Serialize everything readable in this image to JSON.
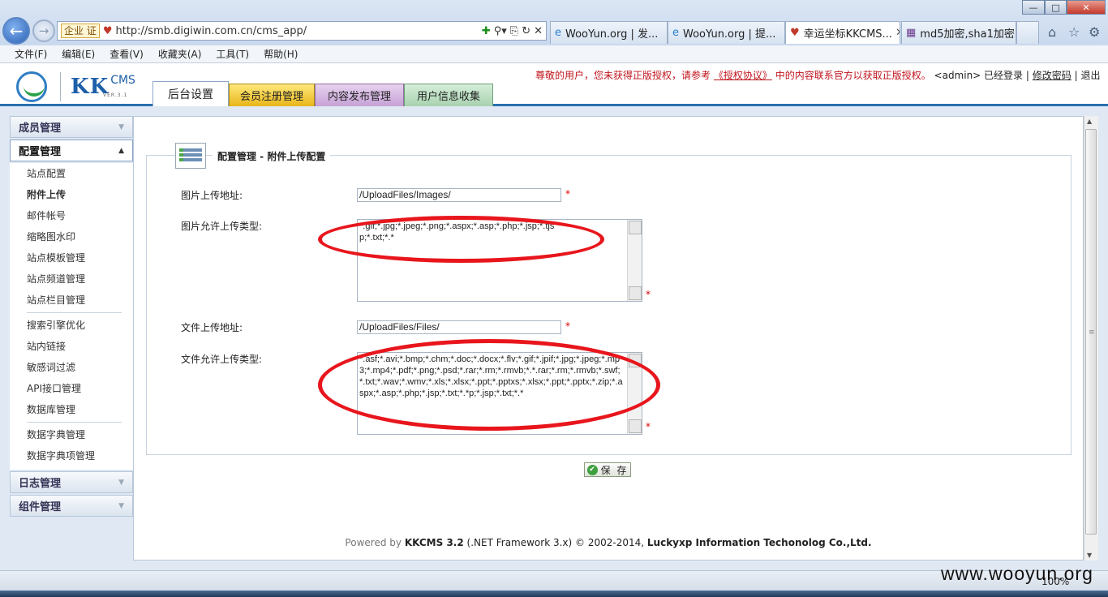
{
  "browser": {
    "address_badge": "企业 证",
    "url": "http://smb.digiwin.com.cn/cms_app/",
    "tabs": [
      {
        "label": "WooYun.org | 发..."
      },
      {
        "label": "WooYun.org | 提..."
      },
      {
        "label": "幸运坐标KKCMS..."
      },
      {
        "label": "md5加密,sha1加密..."
      }
    ],
    "menu": [
      "文件(F)",
      "编辑(E)",
      "查看(V)",
      "收藏夹(A)",
      "工具(T)",
      "帮助(H)"
    ],
    "zoom": "100%"
  },
  "app": {
    "logo_text": "KK",
    "logo_sub": "CMS",
    "logo_version": "VER.3.1",
    "tabs": {
      "settings": "后台设置",
      "member": "会员注册管理",
      "content": "内容发布管理",
      "users": "用户信息收集"
    },
    "notice": {
      "text1": "尊敬的用户，您未获得正版授权，请参考",
      "license_link": "《授权协议》",
      "text2": "中的内容联系官方以获取正版授权。",
      "admin": "<admin> 已经登录",
      "sep": "|",
      "change_password": "修改密码",
      "logout": "退出"
    }
  },
  "sidebar": {
    "groups": [
      {
        "label": "成员管理"
      },
      {
        "label": "配置管理"
      },
      {
        "label": "日志管理"
      },
      {
        "label": "组件管理"
      }
    ],
    "items": [
      "站点配置",
      "附件上传",
      "邮件帐号",
      "缩略图水印",
      "站点模板管理",
      "站点频道管理",
      "站点栏目管理",
      "搜索引擎优化",
      "站内链接",
      "敏感词过滤",
      "API接口管理",
      "数据库管理",
      "数据字典管理",
      "数据字典项管理"
    ]
  },
  "form": {
    "title": "配置管理 - 附件上传配置",
    "image_path_label": "图片上传地址:",
    "image_path_value": "/UploadFiles/Images/",
    "image_types_label": "图片允许上传类型:",
    "image_types_value": "*.gif;*.jpg;*.jpeg;*.png;*.aspx;*.asp;*.php;*.jsp;*.tjsp;*.txt;*.*",
    "file_path_label": "文件上传地址:",
    "file_path_value": "/UploadFiles/Files/",
    "file_types_label": "文件允许上传类型:",
    "file_types_value": "*.asf;*.avi;*.bmp;*.chm;*.doc;*.docx;*.flv;*.gif;*.jpif;*.jpg;*.jpeg;*.mp3;*.mp4;*.pdf;*.png;*.psd;*.rar;*.rm;*.rmvb;*.*.rar;*.rm;*.rmvb;*.swf;*.txt;*.wav;*.wmv;*.xls;*.xlsx;*.ppt;*.pptxs;*.xlsx;*.ppt;*.pptx;*.zip;*.aspx;*.asp;*.php;*.jsp;*.txt;*.*p;*.jsp;*.txt;*.*",
    "required_mark": "*",
    "save_label": "保 存",
    "save_icon": "check-icon"
  },
  "footer": {
    "powered": "Powered by",
    "product": "KKCMS 3.2",
    "framework": "(.NET Framework 3.x) © 2002-2014,",
    "company": "Luckyxp Information Techonolog Co.,Ltd."
  },
  "watermark": "www.wooyun.org"
}
